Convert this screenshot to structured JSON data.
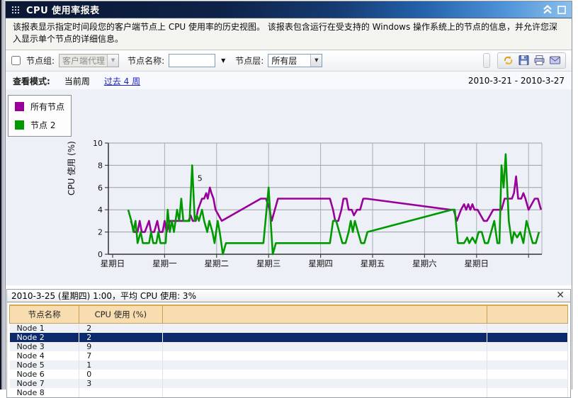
{
  "window": {
    "title": "CPU 使用率报表",
    "collapse_icon": "chevron-double-up-icon",
    "maximize_icon": "square-icon"
  },
  "description": "该报表显示指定时间段您的客户端节点上 CPU 使用率的历史视图。 该报表包含运行在受支持的 Windows 操作系统上的节点的信息，并允许您深入显示单个节点的详细信息。",
  "toolbar": {
    "node_group_label": "节点组:",
    "node_group_value": "客户端代理",
    "node_name_label": "节点名称:",
    "node_name_value": "",
    "node_layer_label": "节点层:",
    "node_layer_value": "所有层",
    "icons": [
      "refresh-icon",
      "save-icon",
      "print-icon",
      "email-icon"
    ]
  },
  "view_mode": {
    "label": "查看模式:",
    "current": "当前周",
    "link": "过去 4 周",
    "date_range": "2010-3-21 - 2010-3-27"
  },
  "legend": [
    {
      "label": "所有节点",
      "color": "#990099"
    },
    {
      "label": "节点 2",
      "color": "#009900"
    }
  ],
  "chart_data": {
    "type": "line",
    "title": "",
    "xlabel": "",
    "ylabel": "CPU 使用 (%)",
    "ylim": [
      0,
      10
    ],
    "yticks": [
      0,
      2,
      4,
      6,
      8,
      10
    ],
    "x_labels": [
      "星期日",
      "星期一",
      "星期二",
      "星期三",
      "星期四",
      "星期五",
      "星期六",
      "星期日"
    ],
    "x_range": [
      0,
      8.3
    ],
    "grid": true,
    "legend_position": "top-left",
    "annotation": {
      "text": "5",
      "x": 1.68,
      "y": 6.6
    },
    "series": [
      {
        "name": "所有节点",
        "color": "#990099",
        "points": [
          [
            0.35,
            3
          ],
          [
            0.42,
            2
          ],
          [
            0.48,
            2
          ],
          [
            0.52,
            3
          ],
          [
            0.56,
            2
          ],
          [
            0.62,
            2
          ],
          [
            0.66,
            2.5
          ],
          [
            0.7,
            3
          ],
          [
            0.74,
            2
          ],
          [
            0.8,
            2
          ],
          [
            0.86,
            3
          ],
          [
            0.9,
            2
          ],
          [
            0.96,
            2
          ],
          [
            1.0,
            3
          ],
          [
            1.04,
            2
          ],
          [
            1.1,
            3
          ],
          [
            1.14,
            3
          ],
          [
            1.2,
            3
          ],
          [
            1.4,
            3
          ],
          [
            1.46,
            3
          ],
          [
            1.5,
            3.5
          ],
          [
            1.54,
            3
          ],
          [
            1.6,
            3
          ],
          [
            1.64,
            4
          ],
          [
            1.68,
            4.5
          ],
          [
            1.72,
            5
          ],
          [
            1.76,
            5
          ],
          [
            1.8,
            5.5
          ],
          [
            1.83,
            5
          ],
          [
            1.87,
            6
          ],
          [
            1.9,
            5.5
          ],
          [
            1.94,
            5
          ],
          [
            1.98,
            4
          ],
          [
            2.04,
            3.5
          ],
          [
            2.1,
            3
          ],
          [
            2.85,
            5
          ],
          [
            2.95,
            5
          ],
          [
            3.02,
            4
          ],
          [
            3.06,
            3
          ],
          [
            3.12,
            4
          ],
          [
            3.18,
            5
          ],
          [
            3.3,
            5
          ],
          [
            4.18,
            5
          ],
          [
            4.24,
            4
          ],
          [
            4.28,
            3
          ],
          [
            4.34,
            3
          ],
          [
            4.4,
            4
          ],
          [
            4.44,
            5
          ],
          [
            4.5,
            5
          ],
          [
            4.54,
            4
          ],
          [
            4.6,
            4
          ],
          [
            4.64,
            3.5
          ],
          [
            4.7,
            4
          ],
          [
            4.76,
            4
          ],
          [
            4.82,
            5
          ],
          [
            4.88,
            5
          ],
          [
            6.5,
            4
          ],
          [
            6.56,
            4
          ],
          [
            6.62,
            3
          ],
          [
            6.66,
            3.5
          ],
          [
            6.7,
            4
          ],
          [
            6.76,
            4.5
          ],
          [
            6.8,
            4
          ],
          [
            6.84,
            4.5
          ],
          [
            6.88,
            4
          ],
          [
            6.92,
            4.5
          ],
          [
            6.96,
            4
          ],
          [
            7.02,
            4
          ],
          [
            7.08,
            3.5
          ],
          [
            7.14,
            3
          ],
          [
            7.2,
            3
          ],
          [
            7.26,
            3.5
          ],
          [
            7.32,
            4
          ],
          [
            7.4,
            4
          ],
          [
            7.48,
            4
          ],
          [
            7.54,
            5
          ],
          [
            7.62,
            5
          ],
          [
            7.68,
            5
          ],
          [
            7.72,
            5.5
          ],
          [
            7.76,
            7
          ],
          [
            7.8,
            5
          ],
          [
            7.86,
            5
          ],
          [
            7.9,
            5.5
          ],
          [
            7.94,
            5
          ],
          [
            8.0,
            4
          ],
          [
            8.06,
            4.5
          ],
          [
            8.12,
            5
          ],
          [
            8.18,
            5
          ],
          [
            8.24,
            4
          ]
        ]
      },
      {
        "name": "节点 2",
        "color": "#009900",
        "points": [
          [
            0.3,
            4
          ],
          [
            0.36,
            3
          ],
          [
            0.4,
            2
          ],
          [
            0.44,
            3
          ],
          [
            0.48,
            1
          ],
          [
            0.54,
            2
          ],
          [
            0.58,
            1
          ],
          [
            0.64,
            1
          ],
          [
            0.7,
            1
          ],
          [
            0.74,
            2
          ],
          [
            0.78,
            1
          ],
          [
            0.84,
            1
          ],
          [
            0.88,
            2
          ],
          [
            0.92,
            1
          ],
          [
            0.98,
            1
          ],
          [
            1.02,
            1
          ],
          [
            1.06,
            4
          ],
          [
            1.1,
            2
          ],
          [
            1.14,
            3
          ],
          [
            1.18,
            2
          ],
          [
            1.24,
            4
          ],
          [
            1.28,
            3
          ],
          [
            1.32,
            5
          ],
          [
            1.36,
            3
          ],
          [
            1.42,
            3
          ],
          [
            1.48,
            3
          ],
          [
            1.53,
            8
          ],
          [
            1.58,
            3
          ],
          [
            1.62,
            3.5
          ],
          [
            1.66,
            3
          ],
          [
            1.72,
            4
          ],
          [
            1.76,
            3
          ],
          [
            1.82,
            2
          ],
          [
            1.86,
            3
          ],
          [
            1.92,
            2
          ],
          [
            1.96,
            1
          ],
          [
            2.02,
            3
          ],
          [
            2.06,
            2
          ],
          [
            2.12,
            0
          ],
          [
            2.18,
            1
          ],
          [
            2.9,
            1
          ],
          [
            2.96,
            4
          ],
          [
            3.0,
            6
          ],
          [
            3.04,
            3
          ],
          [
            3.08,
            0
          ],
          [
            3.14,
            1
          ],
          [
            4.18,
            1
          ],
          [
            4.24,
            3
          ],
          [
            4.3,
            3
          ],
          [
            4.36,
            2
          ],
          [
            4.42,
            1
          ],
          [
            4.48,
            1
          ],
          [
            4.54,
            2
          ],
          [
            4.58,
            3
          ],
          [
            4.62,
            2
          ],
          [
            4.66,
            3
          ],
          [
            4.72,
            2
          ],
          [
            4.78,
            1
          ],
          [
            4.84,
            1
          ],
          [
            4.9,
            2
          ],
          [
            6.52,
            4
          ],
          [
            6.58,
            4
          ],
          [
            6.64,
            1
          ],
          [
            6.7,
            1
          ],
          [
            6.76,
            1
          ],
          [
            6.82,
            1.5
          ],
          [
            6.86,
            1
          ],
          [
            6.92,
            1.5
          ],
          [
            6.98,
            1
          ],
          [
            7.04,
            2
          ],
          [
            7.1,
            2
          ],
          [
            7.16,
            1
          ],
          [
            7.22,
            1
          ],
          [
            7.28,
            2
          ],
          [
            7.34,
            3
          ],
          [
            7.4,
            1
          ],
          [
            7.44,
            1
          ],
          [
            7.48,
            8
          ],
          [
            7.52,
            6
          ],
          [
            7.56,
            9
          ],
          [
            7.62,
            3
          ],
          [
            7.68,
            1
          ],
          [
            7.72,
            2
          ],
          [
            7.78,
            1.5
          ],
          [
            7.84,
            2
          ],
          [
            7.9,
            1
          ],
          [
            7.96,
            3
          ],
          [
            8.02,
            2
          ],
          [
            8.08,
            1
          ],
          [
            8.14,
            1
          ],
          [
            8.2,
            2
          ]
        ]
      }
    ]
  },
  "detail_panel": {
    "header": "2010-3-25 (星期四) 1:00，平均 CPU 使用: 3%",
    "close_label": "✕",
    "columns": [
      "节点名称",
      "CPU 使用 (%)",
      "",
      ""
    ],
    "rows": [
      {
        "name": "Node 1",
        "value": "2"
      },
      {
        "name": "Node 2",
        "value": "2"
      },
      {
        "name": "Node 3",
        "value": "9"
      },
      {
        "name": "Node 4",
        "value": "7"
      },
      {
        "name": "Node 5",
        "value": "1"
      },
      {
        "name": "Node 6",
        "value": "0"
      },
      {
        "name": "Node 7",
        "value": "3"
      },
      {
        "name": "Node 8",
        "value": ""
      }
    ],
    "selected_row": "Node 2"
  }
}
